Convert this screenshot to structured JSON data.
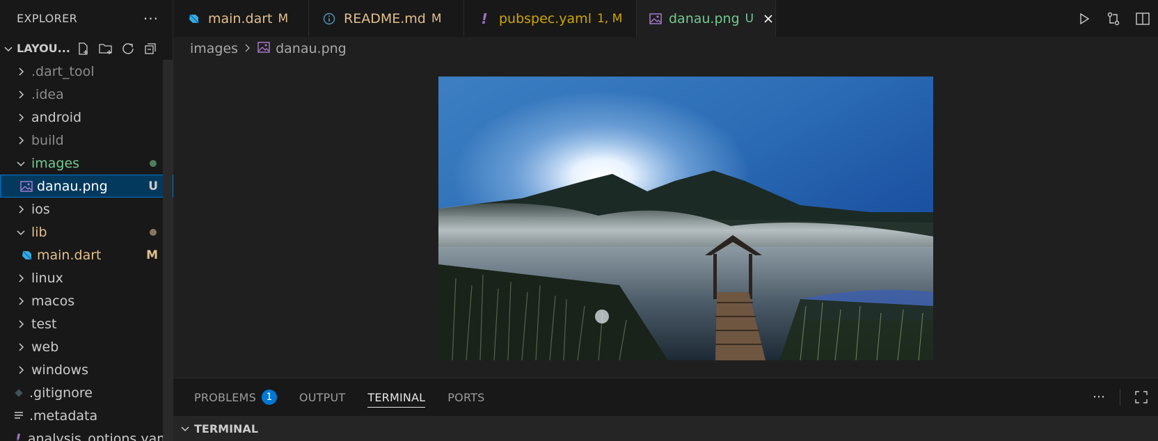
{
  "explorer": {
    "title": "EXPLORER",
    "more": "···",
    "section_name": "LAYOU...",
    "items": [
      {
        "label": ".dart_tool",
        "type": "folder",
        "expanded": false,
        "level": 0
      },
      {
        "label": ".idea",
        "type": "folder",
        "expanded": false,
        "level": 0
      },
      {
        "label": "android",
        "type": "folder",
        "expanded": false,
        "level": 0
      },
      {
        "label": "build",
        "type": "folder",
        "expanded": false,
        "level": 0
      },
      {
        "label": "images",
        "type": "folder",
        "expanded": true,
        "level": 0
      },
      {
        "label": "danau.png",
        "type": "image",
        "badge": "U",
        "level": 1
      },
      {
        "label": "ios",
        "type": "folder",
        "expanded": false,
        "level": 0
      },
      {
        "label": "lib",
        "type": "folder",
        "expanded": true,
        "level": 0
      },
      {
        "label": "main.dart",
        "type": "dart",
        "badge": "M",
        "level": 1
      },
      {
        "label": "linux",
        "type": "folder",
        "expanded": false,
        "level": 0
      },
      {
        "label": "macos",
        "type": "folder",
        "expanded": false,
        "level": 0
      },
      {
        "label": "test",
        "type": "folder",
        "expanded": false,
        "level": 0
      },
      {
        "label": "web",
        "type": "folder",
        "expanded": false,
        "level": 0
      },
      {
        "label": "windows",
        "type": "folder",
        "expanded": false,
        "level": 0
      },
      {
        "label": ".gitignore",
        "type": "git-file",
        "level": 0
      },
      {
        "label": ".metadata",
        "type": "text-file",
        "level": 0
      },
      {
        "label": "analysis_options.yaml",
        "type": "yaml-file",
        "level": 0
      }
    ]
  },
  "tabs": [
    {
      "label": "main.dart",
      "badge": "M",
      "icon": "dart-icon"
    },
    {
      "label": "README.md",
      "badge": "M",
      "icon": "info-icon"
    },
    {
      "label": "pubspec.yaml",
      "badge": "1, M",
      "icon": "yaml-icon"
    },
    {
      "label": "danau.png",
      "badge": "U",
      "icon": "image-icon",
      "active": true
    }
  ],
  "breadcrumb": {
    "folder": "images",
    "file": "danau.png"
  },
  "panel": {
    "tabs": [
      {
        "label": "PROBLEMS",
        "count": "1"
      },
      {
        "label": "OUTPUT"
      },
      {
        "label": "TERMINAL",
        "active": true
      },
      {
        "label": "PORTS"
      }
    ],
    "more": "···",
    "terminal_header": "TERMINAL"
  },
  "colors": {
    "accent": "#0078d4",
    "modified": "#e2c08d",
    "untracked": "#73c991",
    "ignored": "#8c8c8c"
  }
}
